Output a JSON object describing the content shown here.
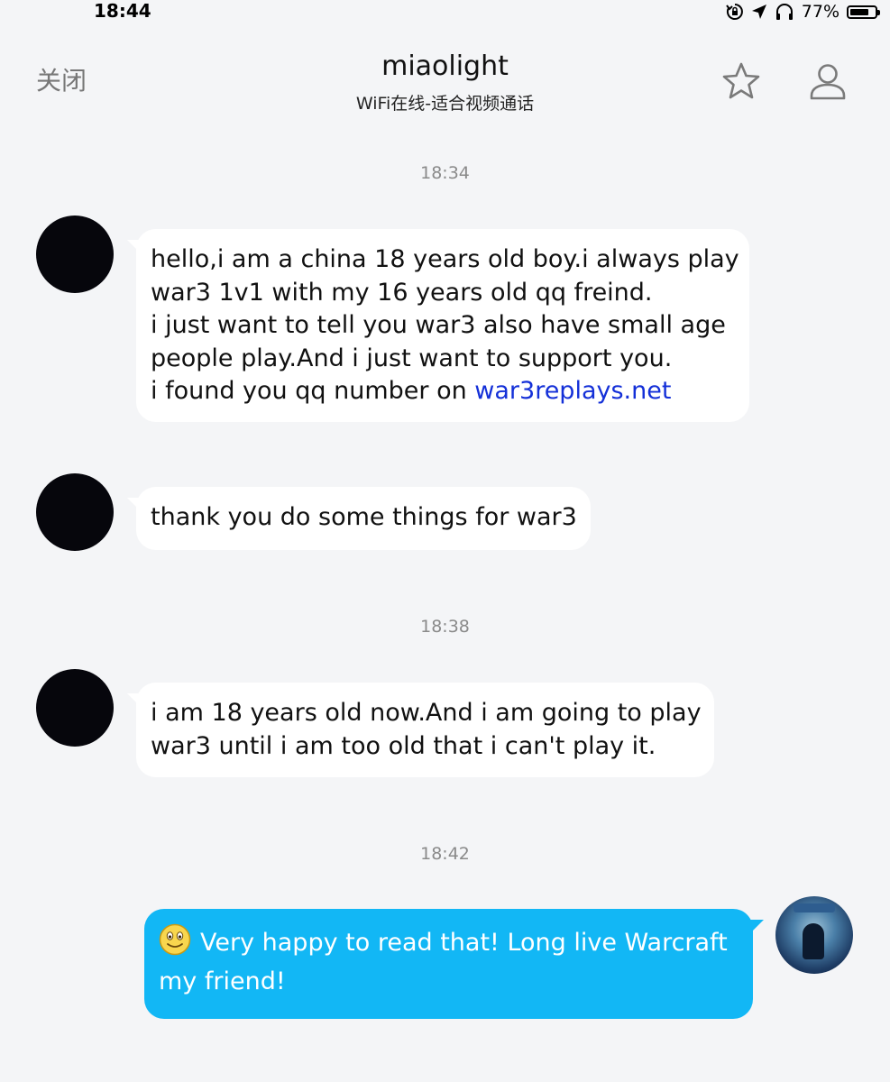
{
  "status_bar": {
    "time": "18:44",
    "battery": "77%",
    "battery_level": 0.77
  },
  "header": {
    "close_label": "关闭",
    "title": "miaolight",
    "subtitle": "WiFi在线-适合视频通话"
  },
  "conversation": {
    "timestamps": [
      "18:34",
      "18:38",
      "18:42"
    ],
    "messages": [
      {
        "sender": "contact",
        "lines": [
          "hello,i am a china 18 years old boy.i always play",
          "war3 1v1 with my 16 years old qq freind.",
          "i just want to tell you war3 also have small age",
          "people play.And i just want to support you.",
          "i found you qq number on "
        ],
        "link": "war3replays.net"
      },
      {
        "sender": "contact",
        "lines": [
          "thank you do some things for war3"
        ]
      },
      {
        "sender": "contact",
        "lines": [
          "i am 18 years old now.And i am going to play",
          "war3 until i am too old that i can't play it."
        ]
      },
      {
        "sender": "self",
        "emoji": "smile-emoji",
        "lines": [
          "Very happy to read that! Long live Warcraft",
          "my friend!"
        ]
      }
    ]
  },
  "colors": {
    "background": "#f4f5f7",
    "self_bubble": "#12b7f5",
    "link": "#1430d8",
    "timestamp": "#8a8a8a"
  },
  "icons": [
    "rotation-lock-icon",
    "location-arrow-icon",
    "headphones-icon",
    "battery-icon",
    "star-icon",
    "profile-icon"
  ]
}
